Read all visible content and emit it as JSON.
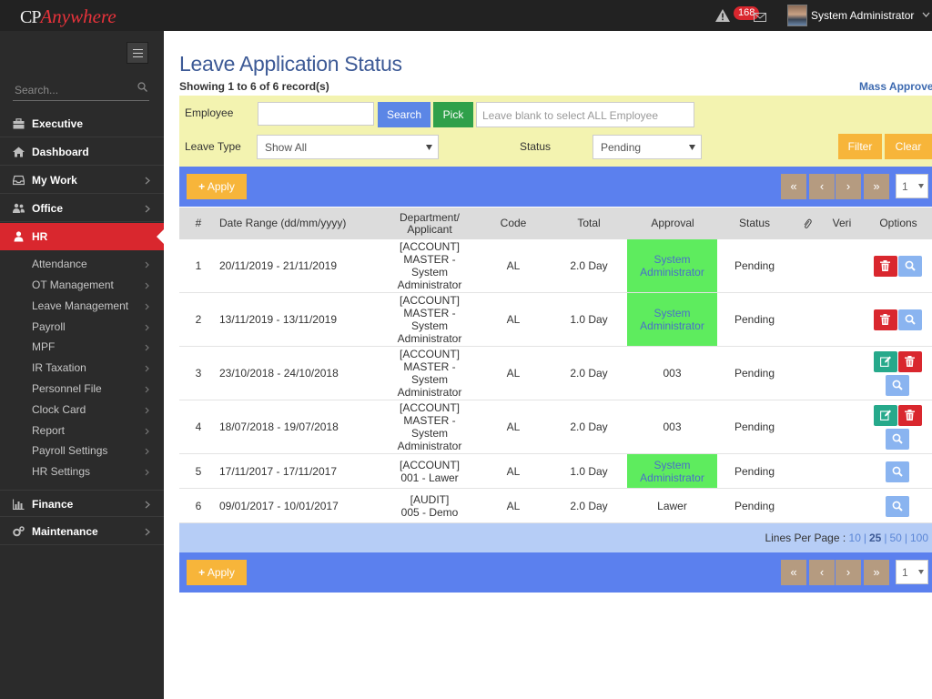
{
  "header": {
    "logo_cp": "CP",
    "logo_anywhere": "Anywhere",
    "notification_count": "168",
    "user_name": "System Administrator"
  },
  "sidebar": {
    "search_placeholder": "Search...",
    "items": [
      {
        "label": "Executive",
        "icon": "briefcase-icon"
      },
      {
        "label": "Dashboard",
        "icon": "home-icon"
      },
      {
        "label": "My Work",
        "icon": "inbox-icon"
      },
      {
        "label": "Office",
        "icon": "users-icon"
      },
      {
        "label": "HR",
        "icon": "user-icon"
      },
      {
        "label": "Finance",
        "icon": "bar-chart-icon"
      },
      {
        "label": "Maintenance",
        "icon": "gears-icon"
      }
    ],
    "hr_subitems": [
      "Attendance",
      "OT Management",
      "Leave Management",
      "Payroll",
      "MPF",
      "IR Taxation",
      "Personnel File",
      "Clock Card",
      "Report",
      "Payroll Settings",
      "HR Settings"
    ]
  },
  "page": {
    "title": "Leave Application Status",
    "record_count": "Showing 1 to 6 of 6 record(s)",
    "mass_approve": "Mass Approve"
  },
  "filter": {
    "employee_label": "Employee",
    "employee_value": "",
    "search_label": "Search",
    "pick_label": "Pick",
    "employee_hint": "Leave blank to select ALL Employee",
    "leave_type_label": "Leave Type",
    "leave_type_value": "Show All",
    "status_label": "Status",
    "status_value": "Pending",
    "filter_label": "Filter",
    "clear_label": "Clear"
  },
  "actions": {
    "apply_label": "Apply",
    "first": "«",
    "prev": "‹",
    "next": "›",
    "last": "»",
    "page": "1"
  },
  "table": {
    "columns": [
      "#",
      "Date Range (dd/mm/yyyy)",
      "Department/\nApplicant",
      "Code",
      "Total",
      "Approval",
      "Status",
      "paperclip-icon",
      "Veri",
      "Options"
    ],
    "rows": [
      {
        "num": "1",
        "date_range": "20/11/2019 - 21/11/2019",
        "dept": "[ACCOUNT]\nMASTER -\nSystem\nAdministrator",
        "code": "AL",
        "total": "2.0 Day",
        "approval": "System\nAdministrator",
        "approval_green": true,
        "status": "Pending",
        "options": [
          "delete",
          "view"
        ]
      },
      {
        "num": "2",
        "date_range": "13/11/2019 - 13/11/2019",
        "dept": "[ACCOUNT]\nMASTER -\nSystem\nAdministrator",
        "code": "AL",
        "total": "1.0 Day",
        "approval": "System\nAdministrator",
        "approval_green": true,
        "status": "Pending",
        "options": [
          "delete",
          "view"
        ]
      },
      {
        "num": "3",
        "date_range": "23/10/2018 - 24/10/2018",
        "dept": "[ACCOUNT]\nMASTER -\nSystem\nAdministrator",
        "code": "AL",
        "total": "2.0 Day",
        "approval": "003",
        "approval_green": false,
        "status": "Pending",
        "options": [
          "edit",
          "delete",
          "view"
        ]
      },
      {
        "num": "4",
        "date_range": "18/07/2018 - 19/07/2018",
        "dept": "[ACCOUNT]\nMASTER -\nSystem\nAdministrator",
        "code": "AL",
        "total": "2.0 Day",
        "approval": "003",
        "approval_green": false,
        "status": "Pending",
        "options": [
          "edit",
          "delete",
          "view"
        ]
      },
      {
        "num": "5",
        "date_range": "17/11/2017 - 17/11/2017",
        "dept": "[ACCOUNT]\n001 - Lawer",
        "code": "AL",
        "total": "1.0 Day",
        "approval": "System\nAdministrator",
        "approval_green": true,
        "status": "Pending",
        "options": [
          "view"
        ]
      },
      {
        "num": "6",
        "date_range": "09/01/2017 - 10/01/2017",
        "dept": "[AUDIT]\n005 - Demo",
        "code": "AL",
        "total": "2.0 Day",
        "approval": "Lawer",
        "approval_green": false,
        "status": "Pending",
        "options": [
          "view"
        ]
      }
    ]
  },
  "lines_per_page": {
    "label": "Lines Per Page :",
    "options": [
      "10",
      "25",
      "50",
      "100"
    ],
    "current": "25"
  },
  "colors": {
    "accent_red": "#d9272e",
    "title_blue": "#3d5a96",
    "action_bar": "#5b80ee",
    "filter_panel": "#f3f3b0",
    "approval_green": "#5eec5e"
  }
}
